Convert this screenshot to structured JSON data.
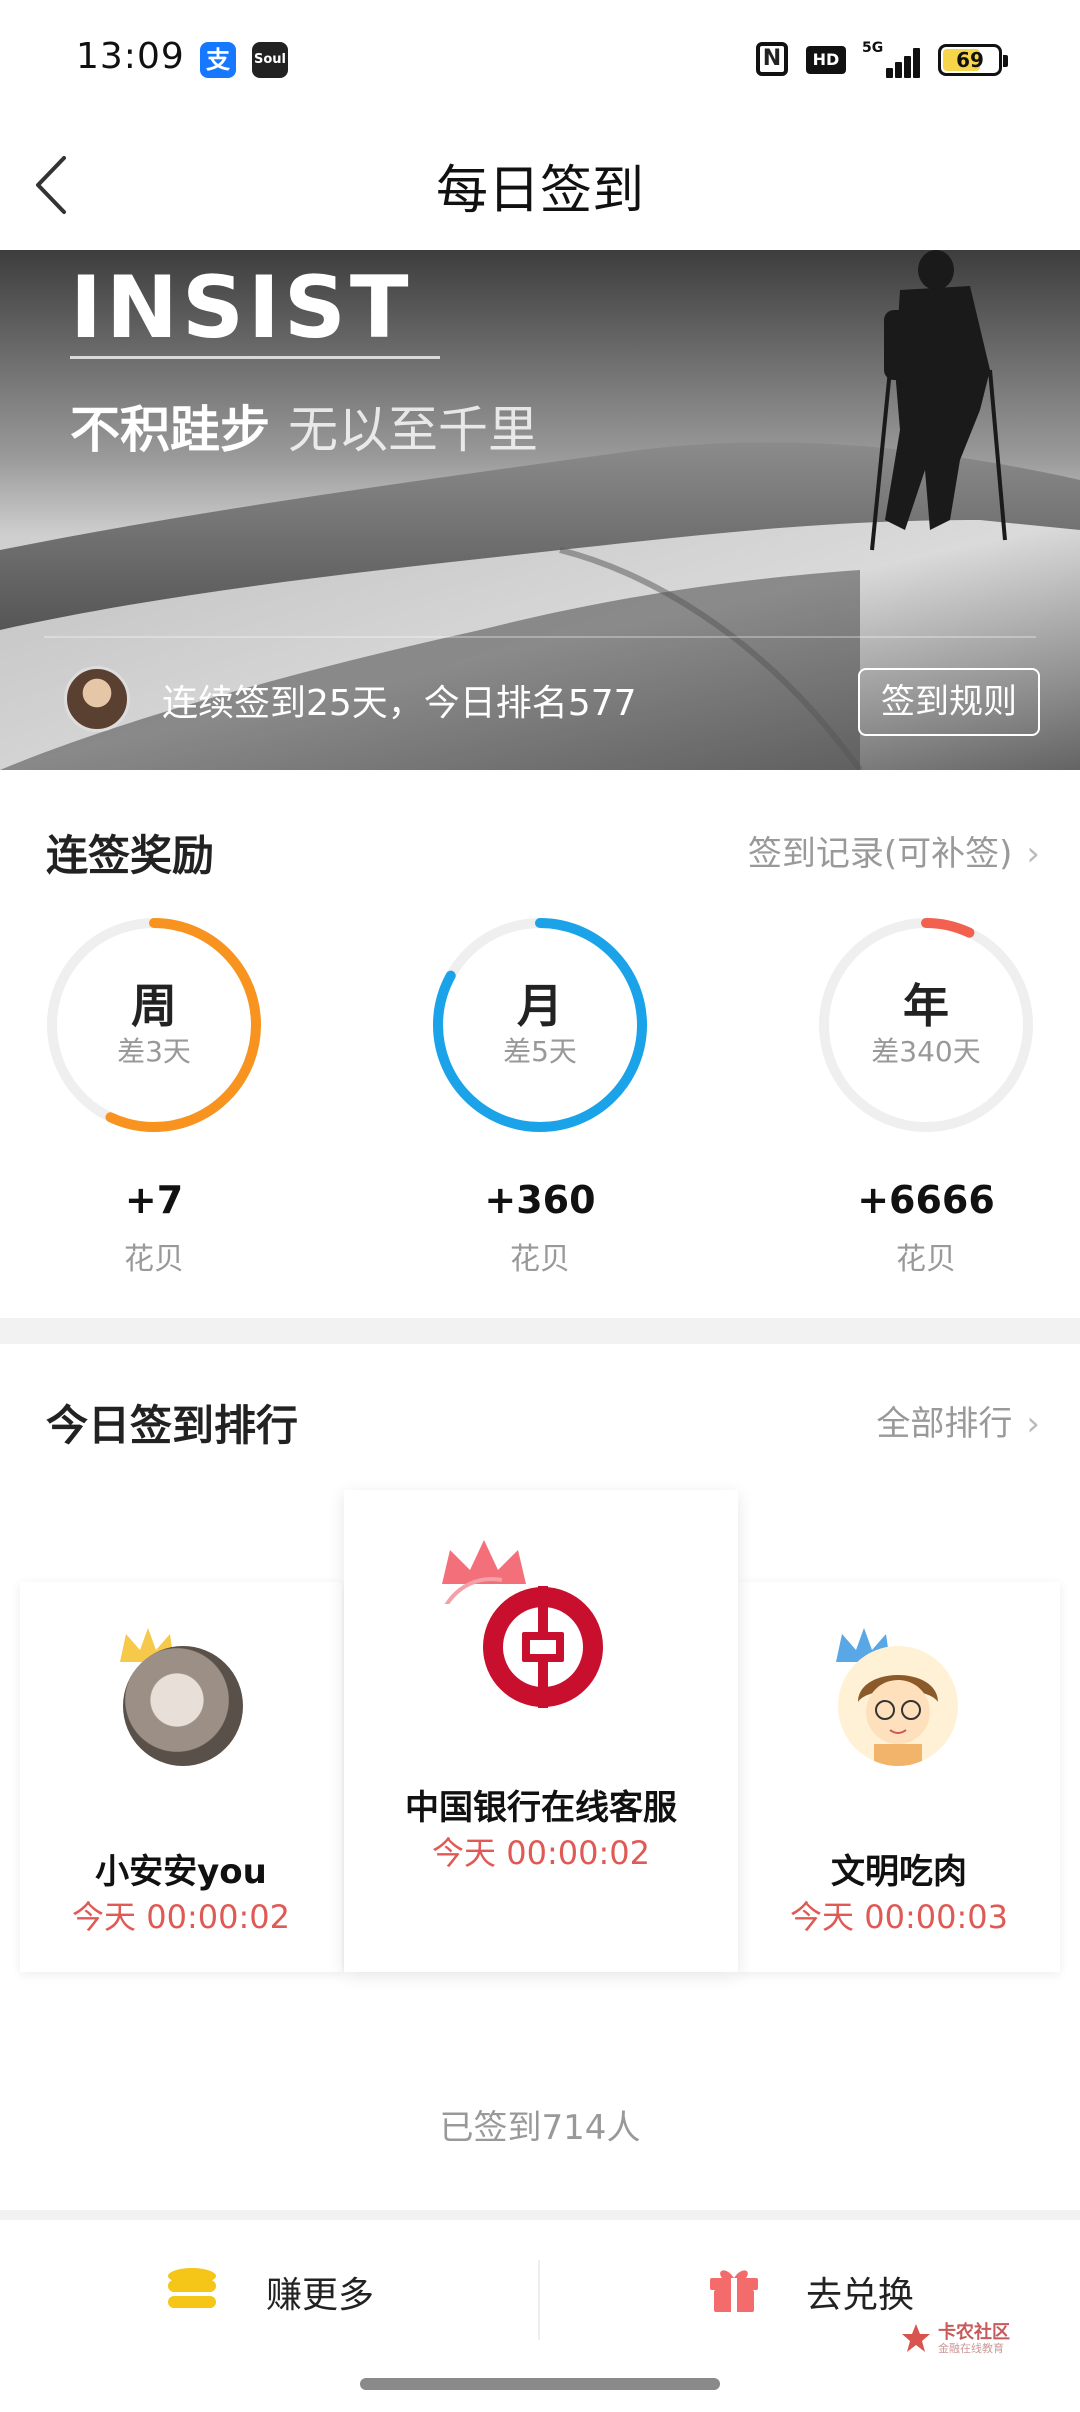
{
  "status_bar": {
    "time": "13:09",
    "app_icons": [
      "alipay-icon",
      "soul-icon"
    ],
    "soul_label": "Soul",
    "alipay_label": "支",
    "nfc_label": "N",
    "hd_label": "HD",
    "network_label": "5G",
    "battery_level": "69"
  },
  "header": {
    "title": "每日签到",
    "back_icon": "chevron-left-icon"
  },
  "banner": {
    "title": "INSIST",
    "slogan_strong": "不积跬步",
    "slogan_rest": "无以至千里",
    "streak_text": "连续签到25天，今日排名577",
    "rules_button": "签到规则"
  },
  "rewards": {
    "title": "连签奖励",
    "record_link": "签到记录(可补签)",
    "items": [
      {
        "period": "周",
        "remaining": "差3天",
        "reward": "+7",
        "unit": "花贝",
        "progress": 0.57,
        "color": "#f7931e"
      },
      {
        "period": "月",
        "remaining": "差5天",
        "reward": "+360",
        "unit": "花贝",
        "progress": 0.83,
        "color": "#1aa3e8"
      },
      {
        "period": "年",
        "remaining": "差340天",
        "reward": "+6666",
        "unit": "花贝",
        "progress": 0.07,
        "color": "#f2614f"
      }
    ]
  },
  "ranking": {
    "title": "今日签到排行",
    "all_link": "全部排行",
    "users": [
      {
        "name": "小安安you",
        "time": "今天 00:00:02",
        "rank": 2
      },
      {
        "name": "中国银行在线客服",
        "time": "今天 00:00:02",
        "rank": 1
      },
      {
        "name": "文明吃肉",
        "time": "今天 00:00:03",
        "rank": 3
      }
    ],
    "checked_in_count": "已签到714人"
  },
  "bottom_bar": {
    "earn_more": "赚更多",
    "redeem": "去兑换"
  },
  "watermark": {
    "text": "卡农社区",
    "sub": "金融在线教育"
  },
  "colors": {
    "accent_red": "#e05a55",
    "week": "#f7931e",
    "month": "#1aa3e8",
    "year": "#f2614f"
  }
}
